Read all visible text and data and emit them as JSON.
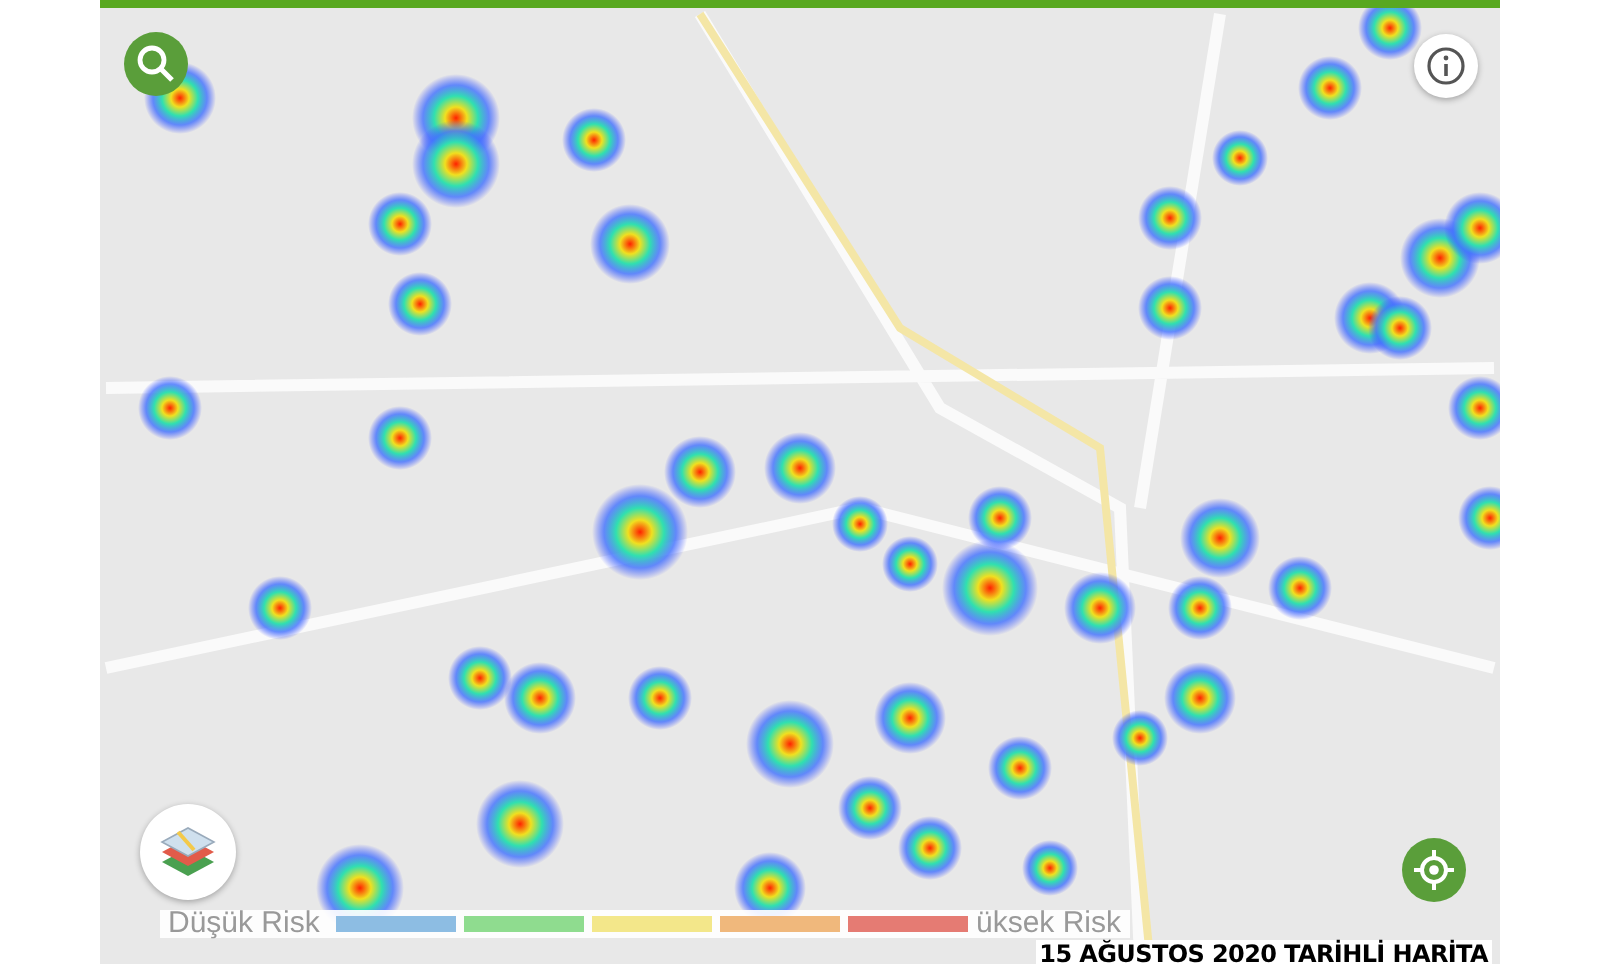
{
  "legend": {
    "low_label": "Düşük Risk",
    "high_label": "üksek Risk",
    "segments": [
      {
        "color": "#8dbde3"
      },
      {
        "color": "#8fdc8f"
      },
      {
        "color": "#f3e78a"
      },
      {
        "color": "#f0b87c"
      },
      {
        "color": "#e57b73"
      }
    ]
  },
  "caption": "15 AĞUSTOS 2020 TARİHLİ HARİTA"
}
